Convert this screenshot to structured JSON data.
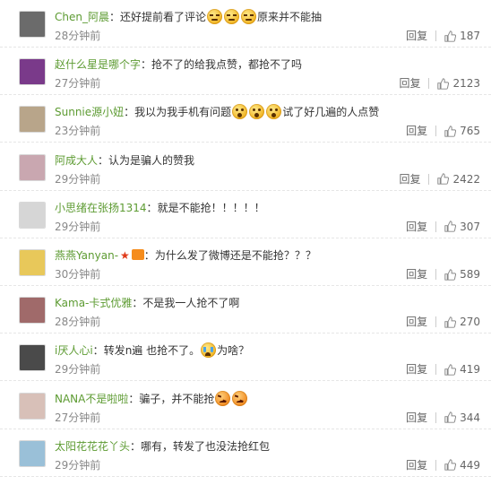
{
  "reply_label": "回复",
  "comments": [
    {
      "user": "Chen_阿晨",
      "text_parts": [
        "还好提前看了评论",
        "",
        "原来并不能抽"
      ],
      "emojis": [
        "smug",
        "smug",
        "smug"
      ],
      "time": "28分钟前",
      "likes": "187",
      "avatar_color": "#6b6b6b"
    },
    {
      "user": "赵什么星是哪个字",
      "text_parts": [
        "抢不了的给我点赞，都抢不了吗"
      ],
      "emojis": [],
      "time": "27分钟前",
      "likes": "2123",
      "avatar_color": "#7a3a8a"
    },
    {
      "user": "Sunnie源小妞",
      "text_parts": [
        "我以为我手机有问题",
        "",
        "试了好几遍的人点赞"
      ],
      "emojis": [
        "wow",
        "wow",
        "wow"
      ],
      "time": "23分钟前",
      "likes": "765",
      "avatar_color": "#b8a58a"
    },
    {
      "user": "阿成大人",
      "text_parts": [
        "认为是骗人的赞我"
      ],
      "emojis": [],
      "time": "29分钟前",
      "likes": "2422",
      "avatar_color": "#c9a7b0"
    },
    {
      "user": "小思绪在张扬1314",
      "text_parts": [
        "就是不能抢！！！！！"
      ],
      "emojis": [],
      "time": "29分钟前",
      "likes": "307",
      "avatar_color": "#d6d6d6"
    },
    {
      "user": "燕燕Yanyan-",
      "text_parts": [
        "为什么发了微博还是不能抢？？？"
      ],
      "emojis": [],
      "time": "30分钟前",
      "likes": "589",
      "avatar_color": "#e8c85a",
      "badges": true
    },
    {
      "user": "Kama-卡式优雅",
      "text_parts": [
        "不是我一人抢不了啊"
      ],
      "emojis": [],
      "time": "28分钟前",
      "likes": "270",
      "avatar_color": "#a06a6a"
    },
    {
      "user": "i厌人心i",
      "text_parts": [
        "转发n遍 也抢不了。",
        "为啥？"
      ],
      "emojis": [
        "cry"
      ],
      "time": "29分钟前",
      "likes": "419",
      "avatar_color": "#4a4a4a"
    },
    {
      "user": "NANA不是啦啦",
      "text_parts": [
        "骗子，并不能抢",
        ""
      ],
      "emojis": [
        "angry",
        "angry"
      ],
      "time": "27分钟前",
      "likes": "344",
      "avatar_color": "#d8c0b8"
    },
    {
      "user": "太阳花花花丫头",
      "text_parts": [
        "哪有，转发了也没法抢红包"
      ],
      "emojis": [],
      "time": "29分钟前",
      "likes": "449",
      "avatar_color": "#9ac0d8"
    }
  ]
}
